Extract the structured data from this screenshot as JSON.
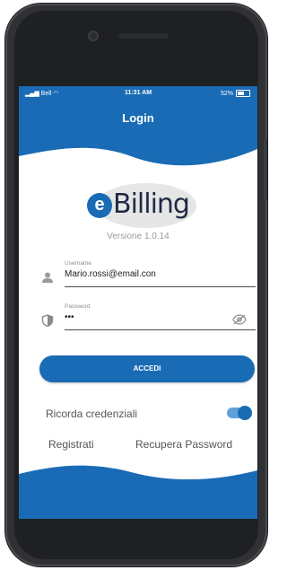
{
  "status_bar": {
    "carrier": "Bell",
    "time": "11:31 AM",
    "battery": "52%"
  },
  "header": {
    "title": "Login"
  },
  "logo": {
    "mark": "e",
    "text": "Billing"
  },
  "version": "Versione 1.0.14",
  "username": {
    "label": "Username",
    "value": "Mario.rossi@email.con"
  },
  "password": {
    "label": "Password",
    "value": "•••"
  },
  "login_button": "ACCEDI",
  "remember": {
    "label": "Ricorda credenziali",
    "enabled": true
  },
  "links": {
    "register": "Registrati",
    "recover": "Recupera Password"
  },
  "colors": {
    "primary": "#1a6bb5",
    "toggle_track": "#5fa0d9",
    "phone_frame": "#2f3134"
  }
}
